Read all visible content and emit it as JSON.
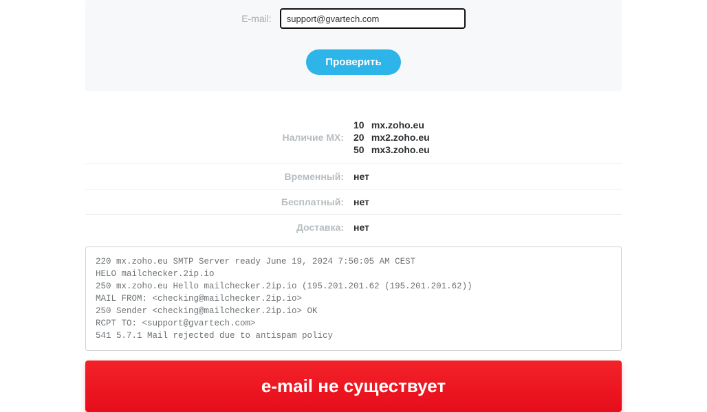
{
  "form": {
    "email_label": "E-mail:",
    "email_value": "support@gvartech.com",
    "check_button": "Проверить"
  },
  "results": {
    "mx_label": "Наличие MX:",
    "mx": [
      {
        "priority": "10",
        "host": "mx.zoho.eu"
      },
      {
        "priority": "20",
        "host": "mx2.zoho.eu"
      },
      {
        "priority": "50",
        "host": "mx3.zoho.eu"
      }
    ],
    "temporary_label": "Временный:",
    "temporary_value": "нет",
    "free_label": "Бесплатный:",
    "free_value": "нет",
    "delivery_label": "Доставка:",
    "delivery_value": "нет"
  },
  "smtp_log": "220 mx.zoho.eu SMTP Server ready June 19, 2024 7:50:05 AM CEST\nHELO mailchecker.2ip.io\n250 mx.zoho.eu Hello mailchecker.2ip.io (195.201.201.62 (195.201.201.62))\nMAIL FROM: <checking@mailchecker.2ip.io>\n250 Sender <checking@mailchecker.2ip.io> OK\nRCPT TO: <support@gvartech.com>\n541 5.7.1 Mail rejected due to antispam policy",
  "banner": {
    "text": "e-mail не существует"
  }
}
